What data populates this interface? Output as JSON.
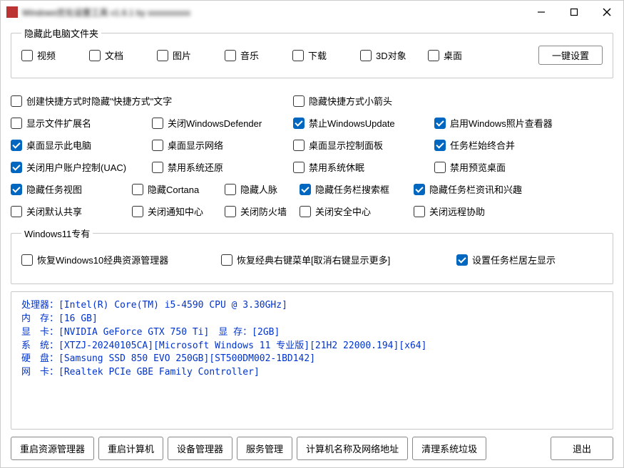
{
  "title": "Windows优化设置工具 v1.6.1 by xxxxxxxxxx",
  "groups": {
    "hide_folders": {
      "legend": "隐藏此电脑文件夹",
      "items": [
        {
          "label": "视频",
          "checked": false
        },
        {
          "label": "文档",
          "checked": false
        },
        {
          "label": "图片",
          "checked": false
        },
        {
          "label": "音乐",
          "checked": false
        },
        {
          "label": "下载",
          "checked": false
        },
        {
          "label": "3D对象",
          "checked": false
        },
        {
          "label": "桌面",
          "checked": false
        }
      ],
      "quick_button": "一键设置"
    },
    "rows": [
      [
        {
          "label": "创建快捷方式时隐藏\"快捷方式\"文字",
          "checked": false,
          "span": 2
        },
        {
          "label": "隐藏快捷方式小箭头",
          "checked": false,
          "span": 2
        }
      ],
      [
        {
          "label": "显示文件扩展名",
          "checked": false
        },
        {
          "label": "关闭WindowsDefender",
          "checked": false
        },
        {
          "label": "禁止WindowsUpdate",
          "checked": true
        },
        {
          "label": "启用Windows照片查看器",
          "checked": true
        }
      ],
      [
        {
          "label": "桌面显示此电脑",
          "checked": true
        },
        {
          "label": "桌面显示网络",
          "checked": false
        },
        {
          "label": "桌面显示控制面板",
          "checked": false
        },
        {
          "label": "任务栏始终合并",
          "checked": true
        }
      ],
      [
        {
          "label": "关闭用户账户控制(UAC)",
          "checked": true
        },
        {
          "label": "禁用系统还原",
          "checked": false
        },
        {
          "label": "禁用系统休眠",
          "checked": false
        },
        {
          "label": "禁用预览桌面",
          "checked": false
        }
      ],
      [
        {
          "label": "隐藏任务视图",
          "checked": true
        },
        {
          "label": "隐藏Cortana",
          "checked": false
        },
        {
          "label": "隐藏人脉",
          "checked": false
        },
        {
          "label": "隐藏任务栏搜索框",
          "checked": true
        },
        {
          "label": "隐藏任务栏资讯和兴趣",
          "checked": true
        }
      ],
      [
        {
          "label": "关闭默认共享",
          "checked": false
        },
        {
          "label": "关闭通知中心",
          "checked": false
        },
        {
          "label": "关闭防火墙",
          "checked": false
        },
        {
          "label": "关闭安全中心",
          "checked": false
        },
        {
          "label": "关闭远程协助",
          "checked": false
        }
      ]
    ],
    "win11": {
      "legend": "Windows11专有",
      "items": [
        {
          "label": "恢复Windows10经典资源管理器",
          "checked": false
        },
        {
          "label": "恢复经典右键菜单[取消右键显示更多]",
          "checked": false
        },
        {
          "label": "设置任务栏居左显示",
          "checked": true
        }
      ]
    }
  },
  "sysinfo": {
    "cpu_label": "处理器：",
    "cpu": "[Intel(R) Core(TM) i5-4590 CPU @ 3.30GHz]",
    "mem_label": "内　存：",
    "mem": "[16 GB]",
    "gpu_label": "显　卡：",
    "gpu": "[NVIDIA GeForce GTX 750 Ti]　显 存：[2GB]",
    "sys_label": "系　统：",
    "sys": "[XTZJ-20240105CA][Microsoft Windows 11 专业版][21H2 22000.194][x64]",
    "disk_label": "硬　盘：",
    "disk": "[Samsung SSD 850 EVO 250GB][ST500DM002-1BD142]",
    "net_label": "网　卡：",
    "net": "[Realtek PCIe GBE Family Controller]"
  },
  "buttons": {
    "restart_explorer": "重启资源管理器",
    "restart_pc": "重启计算机",
    "device_mgr": "设备管理器",
    "service_mgr": "服务管理",
    "netname": "计算机名称及网络地址",
    "clean": "清理系统垃圾",
    "exit": "退出"
  }
}
